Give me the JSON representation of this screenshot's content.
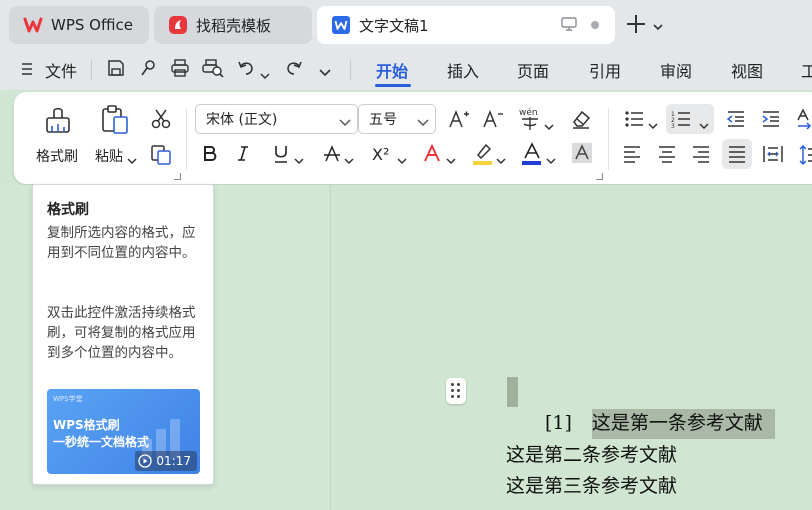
{
  "tabs": [
    {
      "label": "WPS Office"
    },
    {
      "label": "找稻壳模板"
    },
    {
      "label": "文字文稿1"
    }
  ],
  "menu": {
    "file_label": "文件",
    "items": [
      "开始",
      "插入",
      "页面",
      "引用",
      "审阅",
      "视图",
      "工"
    ],
    "active": "开始"
  },
  "ribbon": {
    "format_painter_label": "格式刷",
    "paste_label": "粘贴",
    "font_name": "宋体 (正文)",
    "font_size": "五号",
    "superscript_label": "X²"
  },
  "tooltip": {
    "title": "格式刷",
    "para1": "复制所选内容的格式，应用到不同位置的内容中。",
    "para2": "双击此控件激活持续格式刷，可将复制的格式应用到多个位置的内容中。",
    "video": {
      "brand": "WPS学堂",
      "line1": "WPS格式刷",
      "line2": "一秒统一文档格式",
      "duration": "01:17"
    }
  },
  "document": {
    "ref_marker": "[1]",
    "lines": [
      "这是第一条参考文献",
      "这是第二条参考文献",
      "这是第三条参考文献"
    ]
  },
  "colors": {
    "accent": "#2b5fd9",
    "wps_red": "#e8383d",
    "doc_blue": "#2b6be8",
    "highlight_yellow": "#f4d43a",
    "font_color_blue": "#1f3fd6",
    "selection": "#a9b8a7"
  }
}
